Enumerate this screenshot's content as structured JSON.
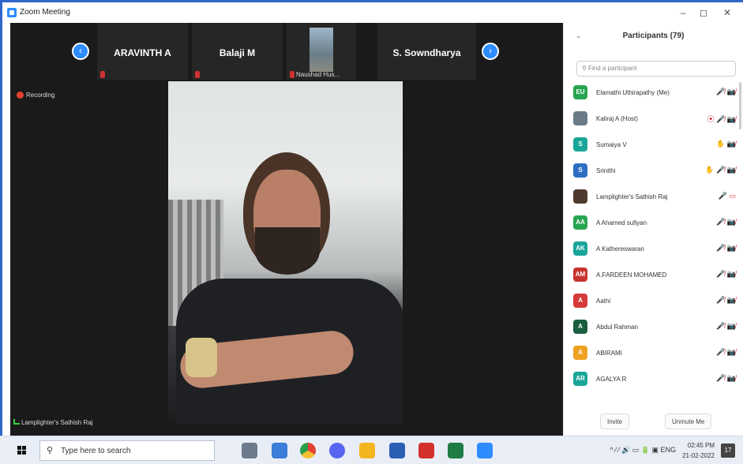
{
  "window": {
    "title": "Zoom Meeting",
    "minimize": "–",
    "maximize": "◻",
    "close": "✕"
  },
  "gallery": {
    "prev_icon": "chevron-left-icon",
    "next_icon": "chevron-right-icon",
    "tiles": [
      {
        "name": "ARAVINTH A"
      },
      {
        "name": "Balaji M"
      },
      {
        "name": "Naushad Hus..."
      },
      {
        "name": "S. Sowndharya"
      }
    ]
  },
  "recording": {
    "label": "Recording"
  },
  "active_speaker": {
    "name": "Lamplighter's Sathish Raj"
  },
  "participants_panel": {
    "title": "Participants (79)",
    "search_placeholder": "Find a participant",
    "participants": [
      {
        "initials": "EU",
        "name": "Elamathi Uthirapathy (Me)",
        "color": "#27a550",
        "icons": "🎤̸ 📷̸"
      },
      {
        "initials": "",
        "name": "Kaliraj A (Host)",
        "color": "#6a7b86",
        "icons": "⦿ 🎤̸ 📷̸"
      },
      {
        "initials": "S",
        "name": "Sumaiya V",
        "color": "#1aa59a",
        "icons": "✋ 📷̸"
      },
      {
        "initials": "S",
        "name": "Srinithi",
        "color": "#2d6fc2",
        "icons": "✋ 🎤̸ 📷̸"
      },
      {
        "initials": "",
        "name": "Lamplighter's Sathish Raj",
        "color": "#4d3b30",
        "icons": "🎤 ▭"
      },
      {
        "initials": "AA",
        "name": "A Ahamed sufiyan",
        "color": "#27a550",
        "icons": "🎤̸ 📷̸"
      },
      {
        "initials": "AK",
        "name": "A Kathereswaran",
        "color": "#1aa59a",
        "icons": "🎤̸ 📷̸"
      },
      {
        "initials": "AM",
        "name": "A.FARDEEN MOHAMED",
        "color": "#c8342f",
        "icons": "🎤̸ 📷̸"
      },
      {
        "initials": "A",
        "name": "Aathi",
        "color": "#d63a3a",
        "icons": "🎤̸ 📷̸"
      },
      {
        "initials": "A",
        "name": "Abdul Rahman",
        "color": "#1b5e3f",
        "icons": "🎤̸ 📷̸"
      },
      {
        "initials": "A",
        "name": "ABIRAMI",
        "color": "#f0a020",
        "icons": "🎤̸ 📷̸"
      },
      {
        "initials": "AR",
        "name": "AGALYA R",
        "color": "#1aa59a",
        "icons": "🎤̸ 📷̸"
      },
      {
        "initials": "",
        "name": "",
        "color": "#d0327a",
        "icons": "🎤̸ 📷̸"
      }
    ],
    "invite_label": "Invite",
    "unmute_label": "Unmute Me"
  },
  "taskbar": {
    "search_placeholder": "Type here to search",
    "apps": [
      "widgets",
      "explorer",
      "chrome",
      "discord",
      "files",
      "word",
      "acrobat",
      "excel",
      "zoom"
    ],
    "tray": "^ ⁄ ⁄ 🔊 ▭ 🔋 ▣ ENG",
    "time": "02:45 PM",
    "date": "21-02-2022",
    "notifications": "17"
  }
}
